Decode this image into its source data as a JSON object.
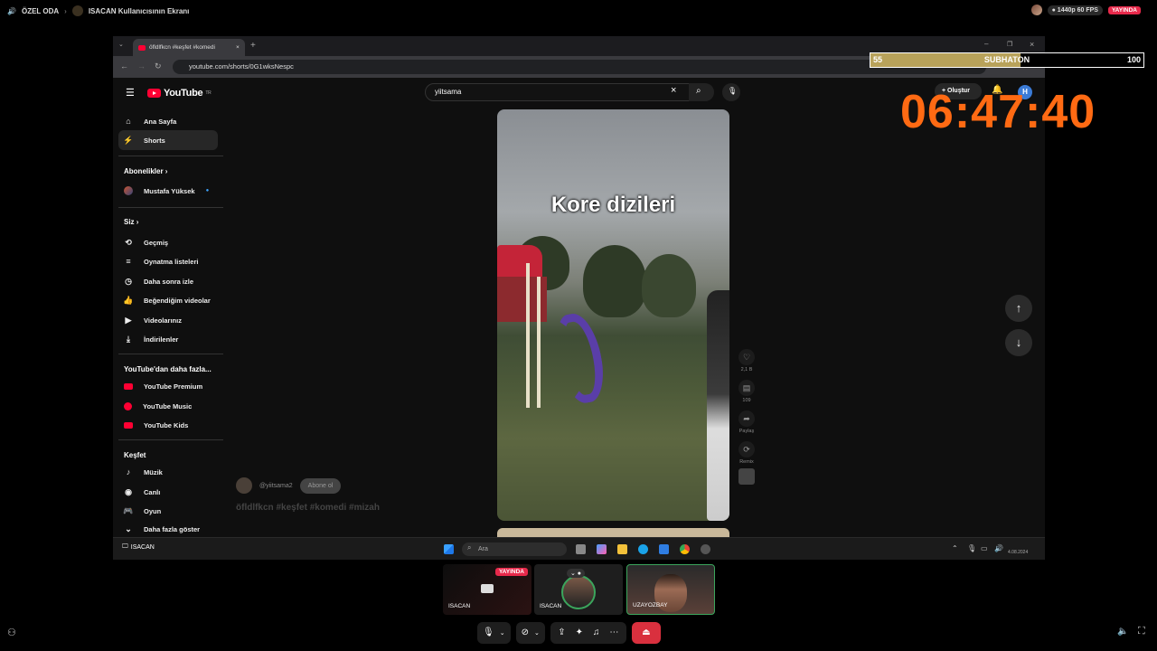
{
  "topbar": {
    "room": "ÖZEL ODA",
    "screen_title": "ISACAN Kullanıcısının Ekranı",
    "quality": "1440p 60 FPS",
    "live_badge": "YAYINDA"
  },
  "browser": {
    "tab_title": "öfldlfkcn #keşfet #komedi",
    "url": "youtube.com/shorts/0G1wksNespc"
  },
  "youtube": {
    "logo": "YouTube",
    "logo_region": "TR",
    "search_value": "yiitsama",
    "create_label": "Oluştur",
    "avatar_letter": "H",
    "sidebar": {
      "home": "Ana Sayfa",
      "shorts": "Shorts",
      "subscriptions_head": "Abonelikler",
      "subscription_1": "Mustafa Yüksek",
      "you_head": "Siz",
      "history": "Geçmiş",
      "playlists": "Oynatma listeleri",
      "watch_later": "Daha sonra izle",
      "liked": "Beğendiğim videolar",
      "your_videos": "Videolarınız",
      "downloads": "İndirilenler",
      "more_head": "YouTube'dan daha fazla...",
      "premium": "YouTube Premium",
      "music": "YouTube Music",
      "kids": "YouTube Kids",
      "explore_head": "Keşfet",
      "music_cat": "Müzik",
      "live": "Canlı",
      "gaming": "Oyun",
      "show_more": "Daha fazla göster"
    },
    "video": {
      "caption": "Kore dizileri",
      "likes": "2,1 B",
      "comments": "109",
      "share": "Paylaş",
      "remix": "Remix",
      "channel": "@yiitsama2",
      "subscribe": "Abone ol",
      "tags": "öfldlfkcn #keşfet #komedi #mizah"
    }
  },
  "taskbar": {
    "search": "Ara",
    "user_label": "ISACAN",
    "date": "4.08.2024"
  },
  "subathon": {
    "left": "55",
    "label": "SUBHATON",
    "right": "100",
    "progress": 0.55,
    "timer": "06:47:40"
  },
  "participants": [
    {
      "name": "ISACAN",
      "badge": "YAYINDA"
    },
    {
      "name": "ISACAN"
    },
    {
      "name": "UZAYOZBAY"
    }
  ],
  "colors": {
    "live": "#e8294b",
    "timer": "#ff6a13",
    "youtube_red": "#ff0033"
  }
}
